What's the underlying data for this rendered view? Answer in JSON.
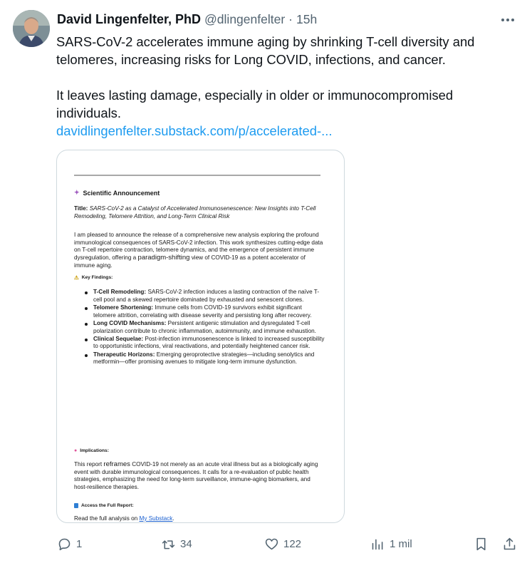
{
  "author": {
    "name": "David Lingenfelter, PhD",
    "handle": "@dlingenfelter",
    "separator": "·",
    "time": "15h"
  },
  "tweet": {
    "line1": "SARS-CoV-2 accelerates immune aging by shrinking T-cell diversity and",
    "line2": "telomeres, increasing risks for Long COVID, infections, and cancer.",
    "line3": "It leaves lasting damage, especially in older or immunocompromised",
    "line4": "individuals.",
    "link": "davidlingenfelter.substack.com/p/accelerated-..."
  },
  "document": {
    "announcement": "Scientific Announcement",
    "title_label": "Title:",
    "title_text": "SARS-CoV-2 as a Catalyst of Accelerated Immunosenescence: New Insights into T-Cell Remodeling, Telomere Attrition, and Long-Term Clinical Risk",
    "intro_a": "I am pleased to announce the release of a comprehensive new analysis exploring the profound immunological consequences of SARS-CoV-2 infection. This work synthesizes cutting-edge data on T-cell repertoire contraction, telomere dynamics, and the emergence of persistent immune dysregulation, offering a",
    "intro_big": "paradigm-shifting",
    "intro_b": "view of COVID-19 as a potent accelerator of immune aging.",
    "key_findings": "Key Findings:",
    "findings": [
      {
        "label": "T-Cell Remodeling:",
        "text": "SARS-CoV-2 infection induces a lasting contraction of the naïve T-cell pool and a skewed repertoire dominated by exhausted and senescent clones."
      },
      {
        "label": "Telomere Shortening:",
        "text": "Immune cells from COVID-19 survivors exhibit significant telomere attrition, correlating with disease severity and persisting long after recovery."
      },
      {
        "label": "Long COVID Mechanisms:",
        "text": "Persistent antigenic stimulation and dysregulated T-cell polarization contribute to chronic inflammation, autoimmunity, and immune exhaustion."
      },
      {
        "label": "Clinical Sequelae:",
        "text": "Post-infection immunosenescence is linked to increased susceptibility to opportunistic infections, viral reactivations, and potentially heightened cancer risk."
      },
      {
        "label": "Therapeutic Horizons:",
        "text": "Emerging geroprotective strategies—including senolytics and metformin—offer promising avenues to mitigate long-term immune dysfunction."
      }
    ],
    "implications": "Implications:",
    "impl_a": "This report",
    "impl_big": "reframes",
    "impl_b": "COVID-19 not merely as an acute viral illness but as a biologically aging event with durable immunological consequences. It calls for a re-evaluation of public health strategies, emphasizing the need for long-term surveillance, immune-aging biomarkers, and host-resilience therapies.",
    "access": "Access the Full Report:",
    "read_prefix": "Read the full analysis on",
    "read_link": "My Substack",
    "read_suffix": "."
  },
  "actions": {
    "replies": "1",
    "reposts": "34",
    "likes": "122",
    "views": "1 mil"
  }
}
